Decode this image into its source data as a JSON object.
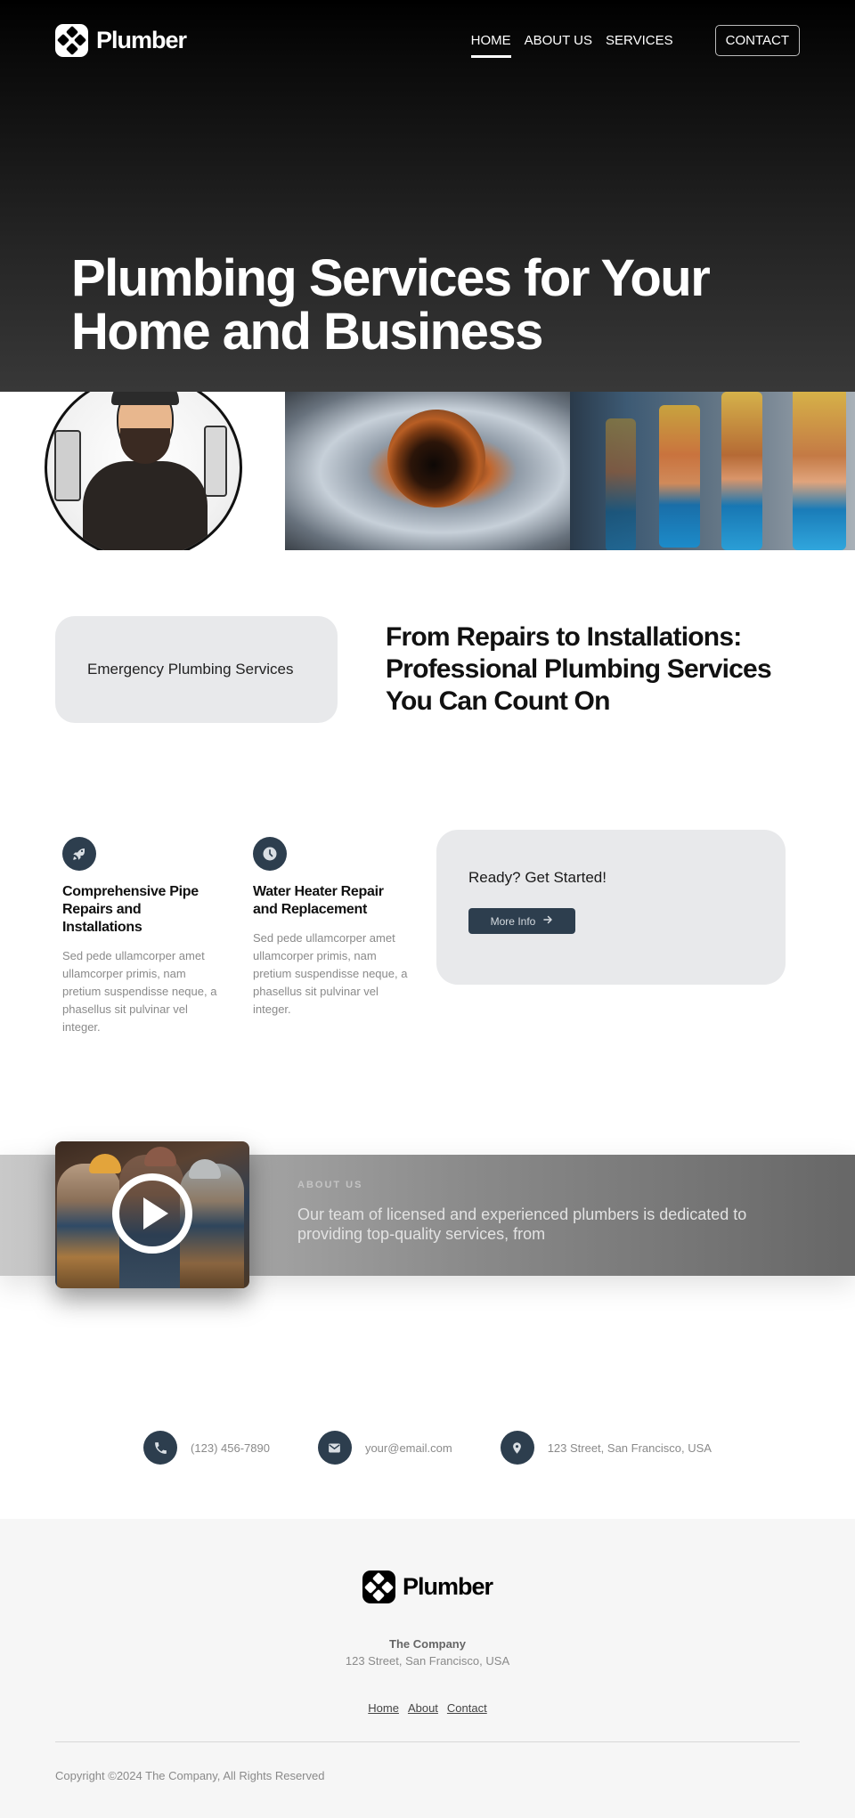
{
  "nav": {
    "brand": "Plumber",
    "links": [
      {
        "label": "HOME",
        "active": true
      },
      {
        "label": "ABOUT US",
        "active": false
      },
      {
        "label": "SERVICES",
        "active": false
      }
    ],
    "contact_button": "CONTACT"
  },
  "hero": {
    "title_line1": "Plumbing Services for Your",
    "title_line2": "Home and Business"
  },
  "gallery": [
    {
      "alt": "Cartoon plumber mascot"
    },
    {
      "alt": "Leaking rusted pipe with water"
    },
    {
      "alt": "Copper pipe valves"
    }
  ],
  "intro": {
    "card_label": "Emergency Plumbing Services",
    "heading": "From Repairs to Installations: Professional Plumbing Services You Can Count On"
  },
  "features": [
    {
      "icon": "rocket-icon",
      "title": "Comprehensive Pipe Repairs and Installations",
      "text": "Sed pede ullamcorper amet ullamcorper primis, nam pretium suspendisse neque, a phasellus sit pulvinar vel integer."
    },
    {
      "icon": "clock-icon",
      "title": "Water Heater Repair and Replacement",
      "text": "Sed pede ullamcorper amet ullamcorper primis, nam pretium suspendisse neque, a phasellus sit pulvinar vel integer."
    }
  ],
  "cta": {
    "title": "Ready? Get Started!",
    "button": "More Info",
    "button_icon": "arrow-right-icon"
  },
  "about": {
    "label": "ABOUT US",
    "body": "Our team of licensed and experienced plumbers is dedicated to providing top-quality services, from"
  },
  "contacts": [
    {
      "icon": "phone-icon",
      "text": "(123) 456-7890"
    },
    {
      "icon": "envelope-icon",
      "text": "your@email.com"
    },
    {
      "icon": "map-pin-icon",
      "text": "123 Street, San Francisco, USA"
    }
  ],
  "footer": {
    "brand": "Plumber",
    "company": "The Company",
    "address": "123 Street, San Francisco, USA",
    "links": [
      "Home",
      "About",
      "Contact"
    ],
    "copyright": "Copyright ©2024 The Company, All Rights Reserved"
  },
  "colors": {
    "accent": "#2d3e4e",
    "card_bg": "#e8e9eb",
    "footer_bg": "#f6f6f6"
  }
}
